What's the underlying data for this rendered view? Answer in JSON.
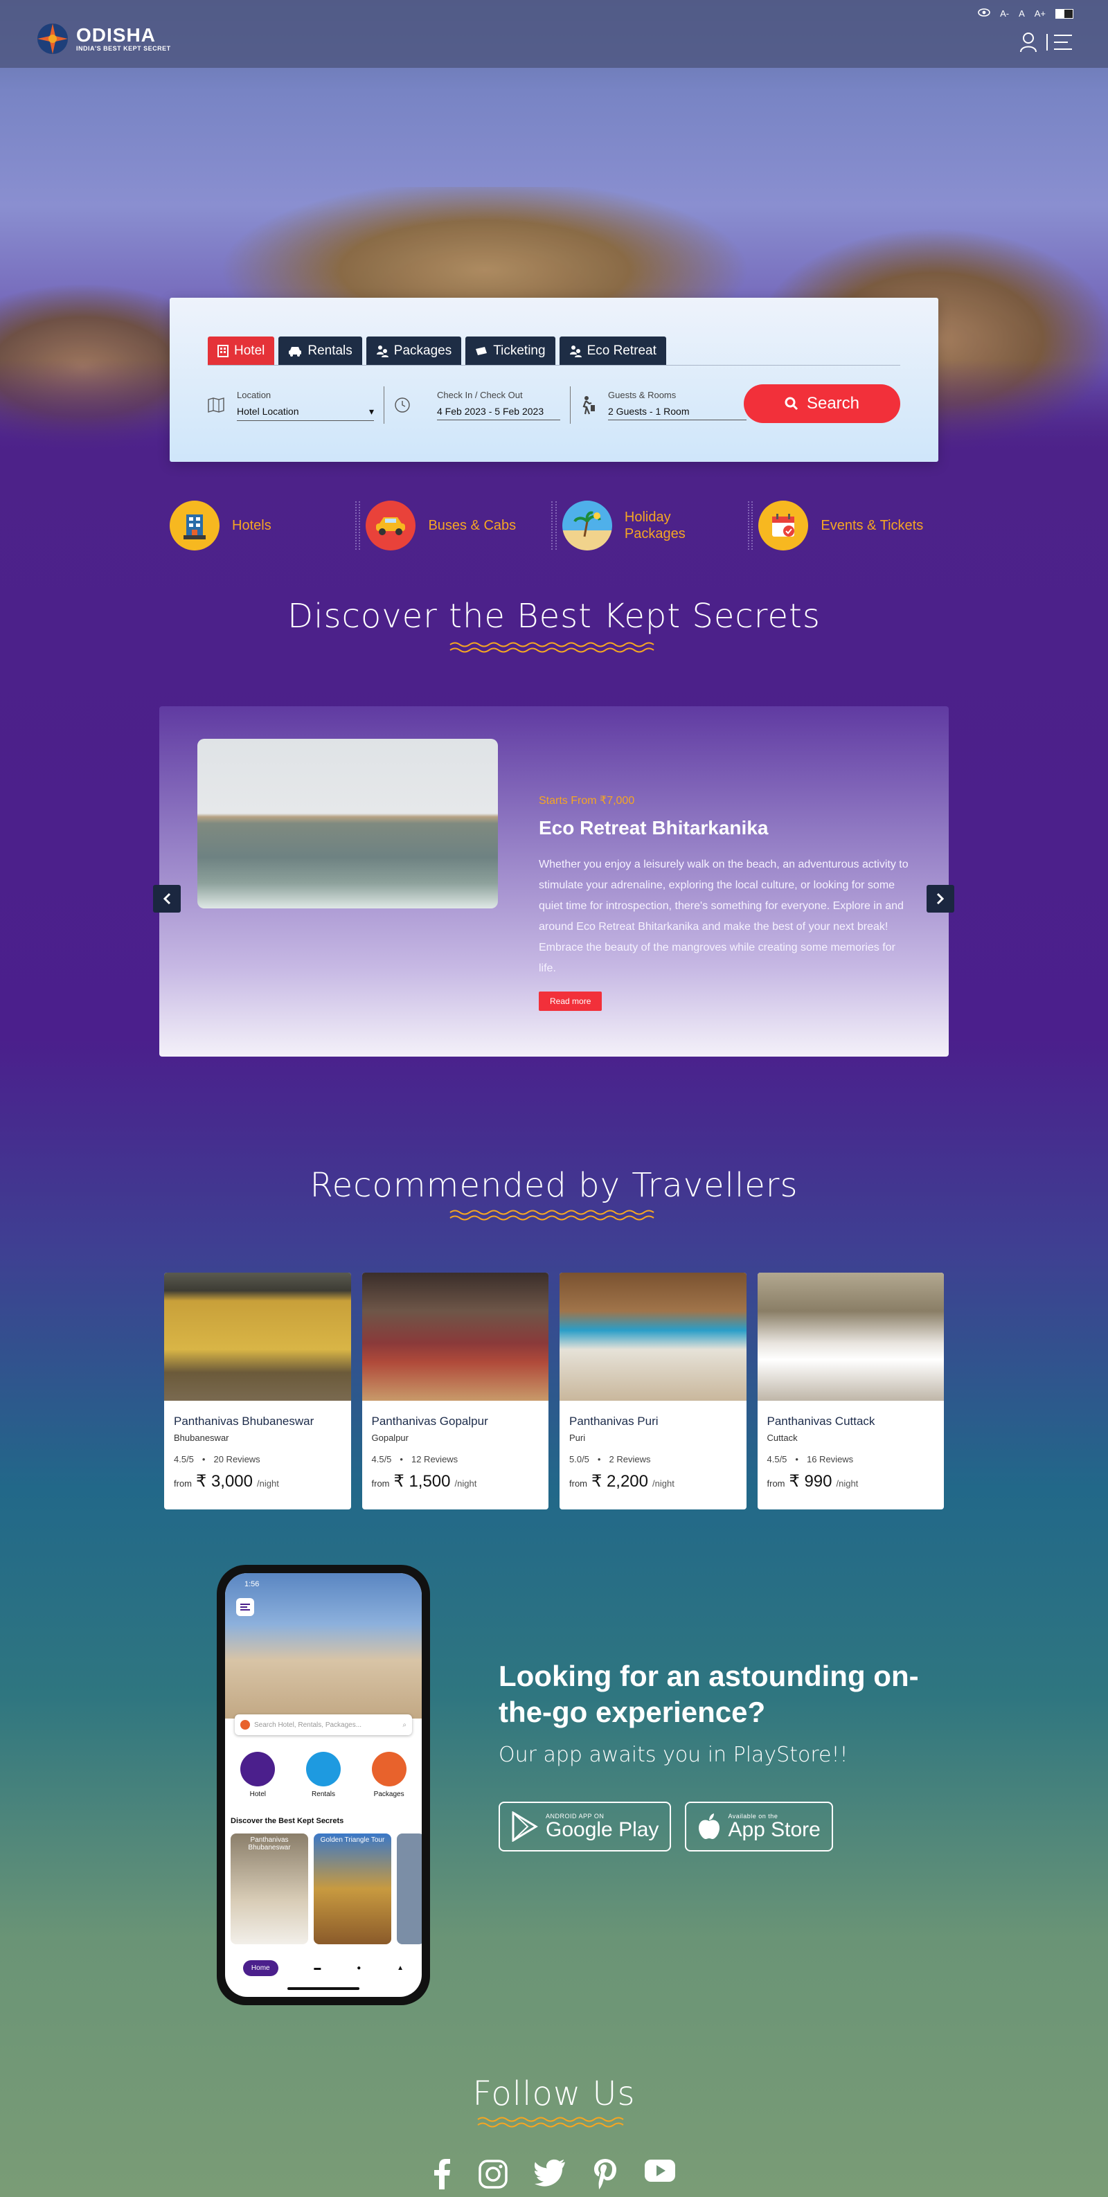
{
  "header": {
    "logo_name": "ODISHA",
    "logo_tagline": "INDIA'S BEST KEPT SECRET",
    "font_small": "A-",
    "font_normal": "A",
    "font_large": "A+"
  },
  "search": {
    "tabs": [
      {
        "label": "Hotel",
        "icon": "hotel-icon",
        "active": true
      },
      {
        "label": "Rentals",
        "icon": "car-icon",
        "active": false
      },
      {
        "label": "Packages",
        "icon": "people-icon",
        "active": false
      },
      {
        "label": "Ticketing",
        "icon": "ticket-icon",
        "active": false
      },
      {
        "label": "Eco Retreat",
        "icon": "people-icon",
        "active": false
      }
    ],
    "location_label": "Location",
    "location_value": "Hotel Location",
    "dates_label": "Check In / Check Out",
    "dates_value": "4 Feb 2023 - 5 Feb 2023",
    "guests_label": "Guests & Rooms",
    "guests_value": "2 Guests - 1 Room",
    "button_label": "Search"
  },
  "categories": [
    {
      "label": "Hotels",
      "icon": "hotel-building-icon"
    },
    {
      "label": "Buses & Cabs",
      "icon": "car-icon"
    },
    {
      "label": "Holiday Packages",
      "icon": "beach-icon"
    },
    {
      "label": "Events & Tickets",
      "icon": "calendar-icon"
    }
  ],
  "discover": {
    "title": "Discover the Best Kept Secrets",
    "slide": {
      "price": "Starts From ₹7,000",
      "title": "Eco Retreat Bhitarkanika",
      "description": "Whether you enjoy a leisurely walk on the beach, an adventurous activity to stimulate your adrenaline, exploring the local culture, or looking for some quiet time for introspection, there's something for everyone. Explore in and around Eco Retreat Bhitarkanika and make the best of your next break! Embrace the beauty of the mangroves while creating some memories for life.",
      "button": "Read more"
    }
  },
  "recommended": {
    "title": "Recommended by Travellers",
    "cards": [
      {
        "name": "Panthanivas Bhubaneswar",
        "city": "Bhubaneswar",
        "rating": "4.5/5",
        "reviews": "20 Reviews",
        "from": "from",
        "price": "₹ 3,000",
        "per": "/night"
      },
      {
        "name": "Panthanivas Gopalpur",
        "city": "Gopalpur",
        "rating": "4.5/5",
        "reviews": "12 Reviews",
        "from": "from",
        "price": "₹ 1,500",
        "per": "/night"
      },
      {
        "name": "Panthanivas Puri",
        "city": "Puri",
        "rating": "5.0/5",
        "reviews": "2 Reviews",
        "from": "from",
        "price": "₹ 2,200",
        "per": "/night"
      },
      {
        "name": "Panthanivas Cuttack",
        "city": "Cuttack",
        "rating": "4.5/5",
        "reviews": "16 Reviews",
        "from": "from",
        "price": "₹ 990",
        "per": "/night"
      }
    ]
  },
  "app": {
    "title": "Looking for an astounding on-the-go experience?",
    "subtitle": "Our app awaits you in PlayStore!!",
    "google_small": "ANDROID APP ON",
    "google_big": "Google Play",
    "apple_small": "Available on the",
    "apple_big": "App Store",
    "phone": {
      "time": "1:56",
      "search_placeholder": "Search Hotel, Rentals, Packages...",
      "icons": [
        "Hotel",
        "Rentals",
        "Packages"
      ],
      "section": "Discover the Best Kept Secrets",
      "tile1": "Panthanivas Bhubaneswar",
      "tile2": "Golden Triangle Tour",
      "nav_home": "Home"
    }
  },
  "follow": {
    "title": "Follow Us",
    "icons": [
      "facebook-icon",
      "instagram-icon",
      "twitter-icon",
      "pinterest-icon",
      "youtube-icon"
    ]
  },
  "colors": {
    "accent": "#f2303a",
    "tab_dark": "#1e2d45",
    "gold": "#f5a623"
  }
}
